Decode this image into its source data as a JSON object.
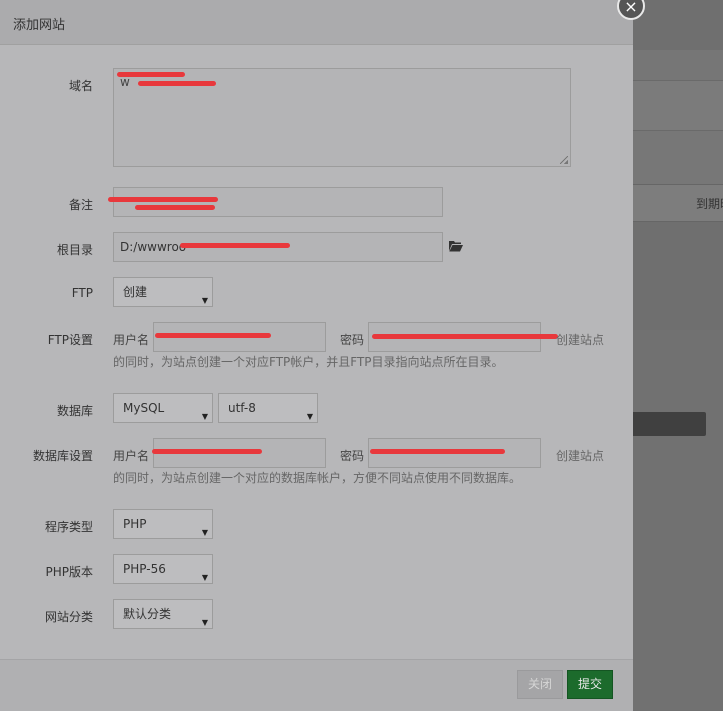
{
  "background": {
    "expiry_column_header": "到期时"
  },
  "dialog": {
    "title": "添加网站",
    "close_icon": "×",
    "domain": {
      "label": "域名",
      "value": "w"
    },
    "remark": {
      "label": "备注",
      "value": ""
    },
    "root_dir": {
      "label": "根目录",
      "value": "D:/wwwroo"
    },
    "ftp": {
      "label": "FTP",
      "selected": "创建"
    },
    "ftp_settings": {
      "label": "FTP设置",
      "username_label": "用户名",
      "password_label": "密码",
      "username_value": "",
      "password_value": "",
      "hint_line1": "创建站点",
      "hint_line2": "的同时，为站点创建一个对应FTP帐户，并且FTP目录指向站点所在目录。"
    },
    "database": {
      "label": "数据库",
      "selected": "MySQL",
      "charset": "utf-8"
    },
    "database_settings": {
      "label": "数据库设置",
      "username_label": "用户名",
      "password_label": "密码",
      "username_value": "",
      "password_value": "",
      "hint_line1": "创建站点",
      "hint_line2": "的同时，为站点创建一个对应的数据库帐户，方便不同站点使用不同数据库。"
    },
    "program_type": {
      "label": "程序类型",
      "selected": "PHP"
    },
    "php_version": {
      "label": "PHP版本",
      "selected": "PHP-56"
    },
    "site_category": {
      "label": "网站分类",
      "selected": "默认分类"
    },
    "footer": {
      "close_label": "关闭",
      "submit_label": "提交"
    }
  },
  "colors": {
    "submit_button": "#1c6b2c",
    "redaction": "#e8383c"
  }
}
